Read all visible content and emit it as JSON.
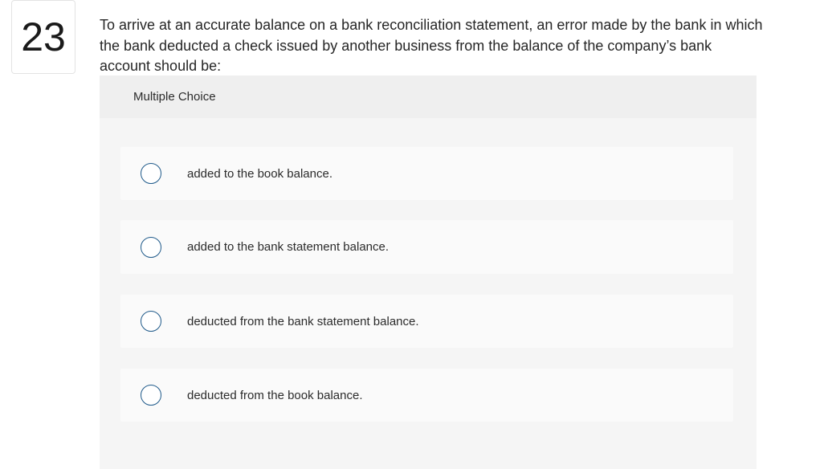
{
  "question": {
    "number": "23",
    "text": "To arrive at an accurate balance on a bank reconciliation statement, an error made by the bank in which the bank deducted a check issued by another business from the balance of the company’s bank account should be:"
  },
  "answer_panel": {
    "header": "Multiple Choice",
    "options": [
      {
        "label": "added to the book balance."
      },
      {
        "label": "added to the bank statement balance."
      },
      {
        "label": "deducted from the bank statement balance."
      },
      {
        "label": "deducted from the book balance."
      }
    ]
  },
  "colors": {
    "radio_border": "#1f5a8a",
    "panel_bg": "#f2f2f2",
    "option_bg": "#fafafa"
  }
}
